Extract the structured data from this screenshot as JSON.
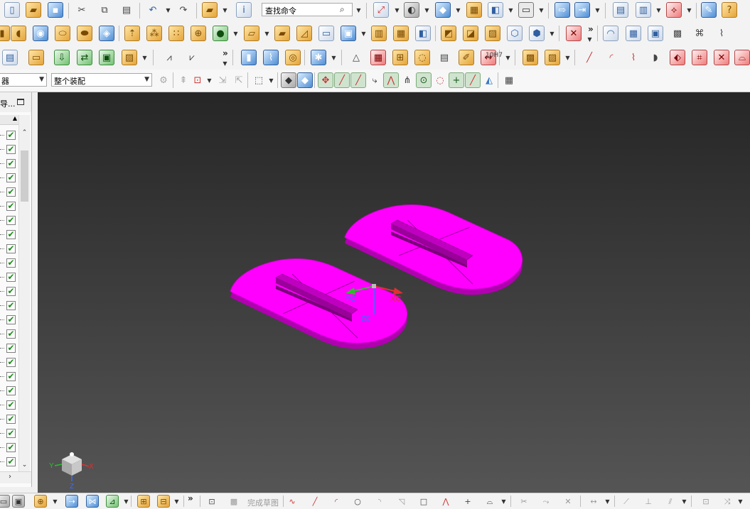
{
  "toolbar": {
    "search": {
      "value": "查找命令"
    },
    "selection_filter": {
      "value": "器"
    },
    "assembly_scope": {
      "value": "整个装配"
    },
    "more_glyph": "»"
  },
  "navigator": {
    "title": "导...",
    "checked_glyph": "✔",
    "checked_count": 24
  },
  "viewport": {
    "background_top": "#262626",
    "background_bottom": "#555555",
    "part_color": "#ff00ff",
    "part_edge_color": "#a000a0",
    "triad_labels": {
      "xc": "XC",
      "yc": "YC",
      "zc": "ZC"
    },
    "view_triad_labels": {
      "x": "X",
      "y": "Y",
      "z": "Z"
    }
  },
  "sketch_bar": {
    "finish_label": "完成草图"
  }
}
